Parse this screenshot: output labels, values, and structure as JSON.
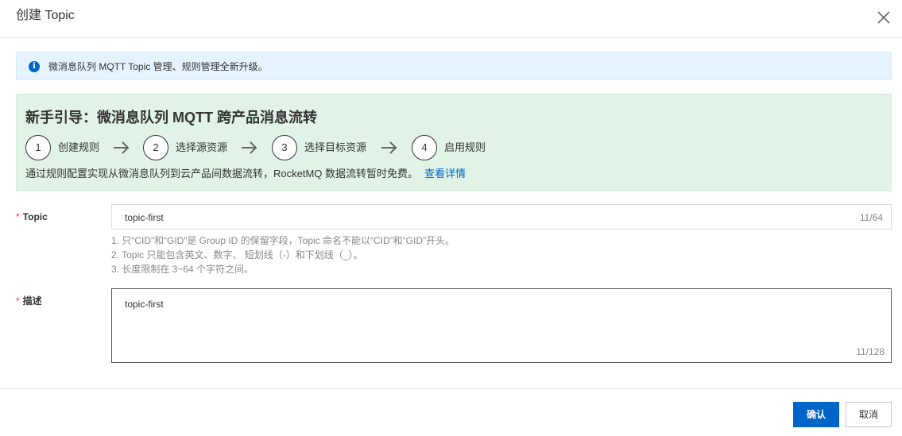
{
  "header": {
    "title": "创建 Topic"
  },
  "info_banner": {
    "text": "微消息队列 MQTT Topic 管理、规则管理全新升级。"
  },
  "guide": {
    "title": "新手引导：微消息队列 MQTT 跨产品消息流转",
    "steps": [
      {
        "num": "1",
        "label": "创建规则"
      },
      {
        "num": "2",
        "label": "选择源资源"
      },
      {
        "num": "3",
        "label": "选择目标资源"
      },
      {
        "num": "4",
        "label": "启用规则"
      }
    ],
    "description": "通过规则配置实现从微消息队列到云产品间数据流转，RocketMQ 数据流转暂时免费。",
    "link": "查看详情"
  },
  "form": {
    "required_mark": "*",
    "topic": {
      "label": "Topic",
      "value": "topic-first",
      "count": "11/64",
      "hints": [
        "1. 只“CID”和“GID”是 Group ID 的保留字段，Topic 命名不能以“CID”和“GID”开头。",
        "2. Topic 只能包含英文、数字、 短划线（-）和下划线（_）。",
        "3. 长度限制在 3~64 个字符之间。"
      ]
    },
    "description": {
      "label": "描述",
      "value": "topic-first",
      "count": "11/128"
    }
  },
  "footer": {
    "confirm_label": "确认",
    "cancel_label": "取消"
  },
  "colors": {
    "primary": "#0064c8",
    "info_bg": "#e5f3ff",
    "guide_bg": "#e0f3e6",
    "required": "#f23c3c"
  },
  "icons": {
    "close": "close-icon",
    "info": "info-icon",
    "arrow": "arrow-right-icon"
  }
}
